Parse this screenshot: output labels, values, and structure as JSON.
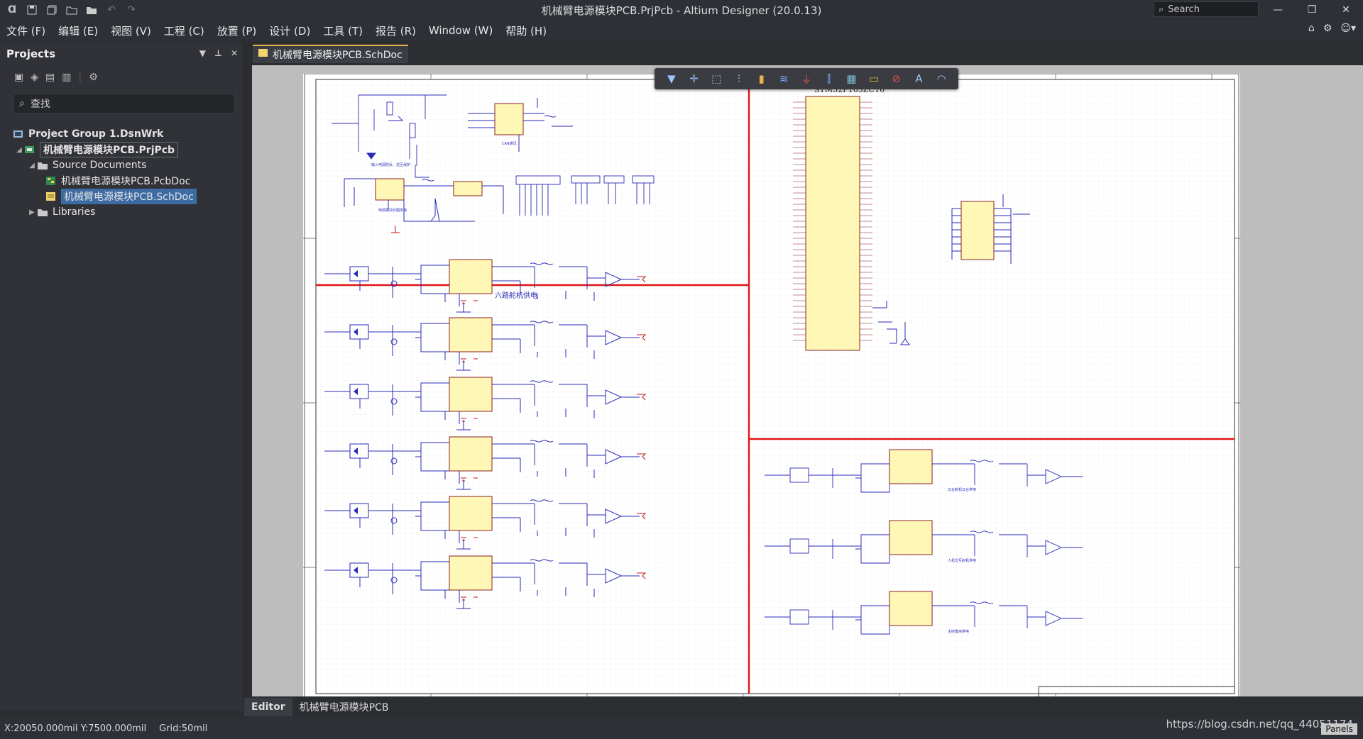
{
  "window": {
    "title": "机械臂电源模块PCB.PrjPcb - Altium Designer (20.0.13)",
    "search_placeholder": "Search"
  },
  "menu": [
    "文件 (F)",
    "编辑 (E)",
    "视图 (V)",
    "工程 (C)",
    "放置 (P)",
    "设计 (D)",
    "工具 (T)",
    "报告 (R)",
    "Window (W)",
    "帮助 (H)"
  ],
  "projects_panel": {
    "title": "Projects",
    "search_placeholder": "查找",
    "tree": {
      "group": "Project Group 1.DsnWrk",
      "project": "机械臂电源模块PCB.PrjPcb",
      "source_folder": "Source Documents",
      "pcb_doc": "机械臂电源模块PCB.PcbDoc",
      "sch_doc": "机械臂电源模块PCB.SchDoc",
      "libraries": "Libraries"
    }
  },
  "document_tab": "机械臂电源模块PCB.SchDoc",
  "schematic": {
    "mcu_title": "STM32F103ZCT6",
    "section_servo": "六路舵机供电",
    "caption_input_protect": "输入电源防反、过压保护",
    "caption_can": "CAN通讯",
    "caption_power_module": "电源模块外围供电",
    "caption_gimbal": "云台舵机云台供电",
    "caption_head": "人机交互舵机供电",
    "caption_main": "主控模块供电"
  },
  "bottom_tabs": [
    "Editor",
    "机械臂电源模块PCB"
  ],
  "status": {
    "coords": "X:20050.000mil Y:7500.000mil",
    "grid": "Grid:50mil"
  },
  "watermark": "https://blog.csdn.net/qq_44051174",
  "panels_button": "Panels"
}
